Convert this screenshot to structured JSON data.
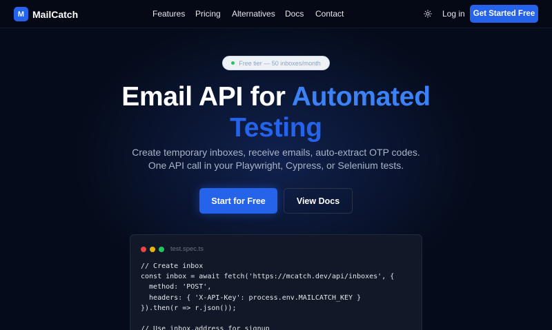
{
  "brand": {
    "logo_letter": "M",
    "name": "MailCatch",
    "accent": "#2563eb"
  },
  "nav": {
    "links": [
      "Features",
      "Pricing",
      "Alternatives",
      "Docs",
      "Contact"
    ],
    "theme_icon": "sun-icon",
    "login_label": "Log in",
    "cta_label": "Get Started Free"
  },
  "hero": {
    "badge": "Free tier — 50 inboxes/month",
    "headline_white": "Email API for ",
    "headline_blue": "Automated",
    "headline_line2": "Testing",
    "subtitle_line1": "Create temporary inboxes, receive emails, auto-extract OTP codes.",
    "subtitle_line2": "One API call in your Playwright, Cypress, or Selenium tests.",
    "primary_button": "Start for Free",
    "secondary_button": "View Docs"
  },
  "code_window": {
    "filename": "test.spec.ts",
    "lines": [
      "// Create inbox",
      "const inbox = await fetch('https://mcatch.dev/api/inboxes', {",
      "  method: 'POST',",
      "  headers: { 'X-API-Key': process.env.MAILCATCH_KEY }",
      "}).then(r => r.json());",
      "",
      "// Use inbox.address for signup"
    ]
  }
}
